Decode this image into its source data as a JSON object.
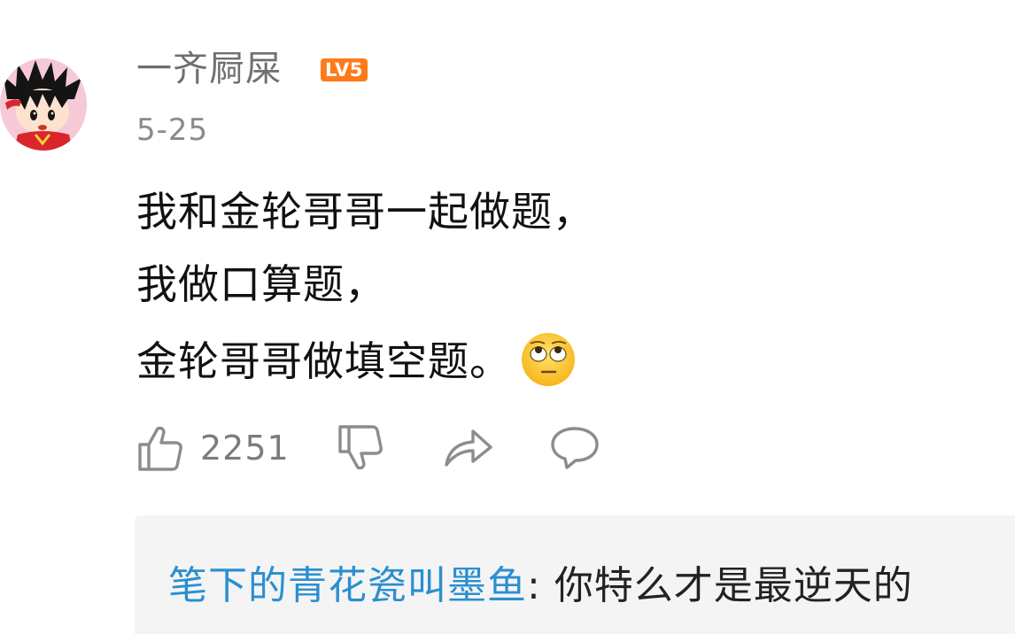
{
  "comment": {
    "username": "一齐屙屎",
    "level": "LV5",
    "date": "5-25",
    "body_lines": [
      "我和金轮哥哥一起做题，",
      "我做口算题，",
      "金轮哥哥做填空题。"
    ],
    "emoji": "eye-roll-emoji",
    "like_count": "2251"
  },
  "reply": {
    "author": "笔下的青花瓷叫墨鱼",
    "separator": ": ",
    "text": "你特么才是最逆天的"
  },
  "colors": {
    "reply_author": "#2a8fd0",
    "level_badge": "#ff7a1a",
    "icon_gray": "#8c8c8c"
  },
  "icons": {
    "like": "thumbs-up-icon",
    "dislike": "thumbs-down-icon",
    "share": "share-arrow-icon",
    "comment": "comment-bubble-icon"
  }
}
